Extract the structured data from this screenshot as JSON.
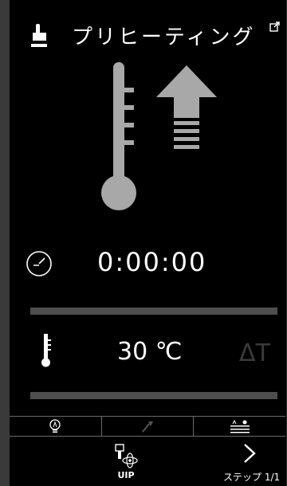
{
  "header": {
    "title": "プリヒーティング",
    "hand_icon": "pointing-hand-icon",
    "export_icon": "export-icon"
  },
  "hero": {
    "thermometer_icon": "thermometer-large-icon",
    "arrow_icon": "heat-up-arrow-icon"
  },
  "timer": {
    "icon": "clock-icon",
    "value": "0:00:00"
  },
  "temperature": {
    "icon": "thermometer-small-icon",
    "value": "30 ℃",
    "delta_label": "ΔT"
  },
  "function_bar": {
    "items": [
      {
        "icon": "lamp-icon"
      },
      {
        "icon": "probe-icon"
      },
      {
        "icon": "settings-lines-icon"
      }
    ]
  },
  "bottom": {
    "uip_label": "UIP",
    "uip_icon": "uip-cleaning-icon",
    "step_icon": "chevron-right-icon",
    "step_label": "ステップ 1/1"
  },
  "colors": {
    "background": "#000000",
    "graphic_gray": "#a8a8a8",
    "bar_gray": "#4e4e4e",
    "text": "#ffffff"
  }
}
